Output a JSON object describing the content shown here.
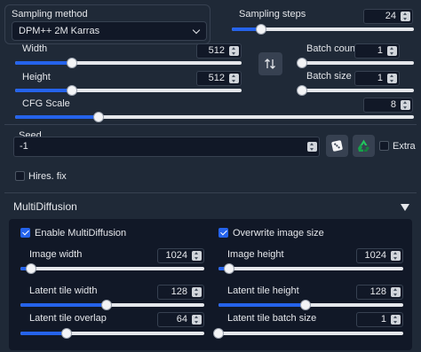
{
  "sampling_method": {
    "label": "Sampling method",
    "value": "DPM++ 2M Karras"
  },
  "sampling_steps": {
    "label": "Sampling steps",
    "value": "24",
    "level": 0.16
  },
  "width": {
    "label": "Width",
    "value": "512",
    "level": 0.25
  },
  "height": {
    "label": "Height",
    "value": "512",
    "level": 0.25
  },
  "batch_count": {
    "label": "Batch count",
    "value": "1",
    "level": 0.0
  },
  "batch_size": {
    "label": "Batch size",
    "value": "1",
    "level": 0.0
  },
  "cfg_scale": {
    "label": "CFG Scale",
    "value": "8",
    "level": 0.21
  },
  "seed": {
    "label": "Seed",
    "value": "-1"
  },
  "extra": {
    "label": "Extra"
  },
  "hires_fix": {
    "label": "Hires. fix"
  },
  "multidiffusion": {
    "title": "MultiDiffusion",
    "enable_label": "Enable MultiDiffusion",
    "overwrite_label": "Overwrite image size",
    "image_width": {
      "label": "Image width",
      "value": "1024",
      "level": 0.06
    },
    "image_height": {
      "label": "Image height",
      "value": "1024",
      "level": 0.06
    },
    "latent_tile_width": {
      "label": "Latent tile width",
      "value": "128",
      "level": 0.47
    },
    "latent_tile_height": {
      "label": "Latent tile height",
      "value": "128",
      "level": 0.47
    },
    "latent_tile_overlap": {
      "label": "Latent tile overlap",
      "value": "64",
      "level": 0.25
    },
    "latent_tile_batch_size": {
      "label": "Latent tile batch size",
      "value": "1",
      "level": 0.0
    }
  },
  "colors": {
    "accent": "#2563eb",
    "panel": "#1f2937",
    "input": "#111827"
  },
  "icons": {
    "swap": "swap-dimensions-icon",
    "dice": "dice-icon",
    "recycle": "recycle-icon",
    "collapse": "triangle-down-icon"
  }
}
